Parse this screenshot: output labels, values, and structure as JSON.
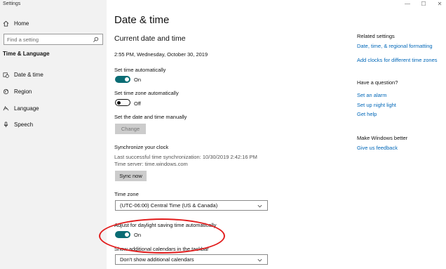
{
  "window": {
    "title": "Settings"
  },
  "sidebar": {
    "home_label": "Home",
    "search_placeholder": "Find a setting",
    "section_label": "Time & Language",
    "items": [
      {
        "label": "Date & time",
        "icon": "calendar-clock-icon"
      },
      {
        "label": "Region",
        "icon": "globe-icon"
      },
      {
        "label": "Language",
        "icon": "language-icon"
      },
      {
        "label": "Speech",
        "icon": "microphone-icon"
      }
    ]
  },
  "main": {
    "page_title": "Date & time",
    "section_title": "Current date and time",
    "current_datetime": "2:55 PM, Wednesday, October 30, 2019",
    "set_time_auto": {
      "label": "Set time automatically",
      "state": "On"
    },
    "set_timezone_auto": {
      "label": "Set time zone automatically",
      "state": "Off"
    },
    "set_manual": {
      "label": "Set the date and time manually",
      "button": "Change"
    },
    "sync": {
      "title": "Synchronize your clock",
      "last_sync": "Last successful time synchronization: 10/30/2019 2:42:16 PM",
      "server": "Time server: time.windows.com",
      "button": "Sync now"
    },
    "timezone": {
      "label": "Time zone",
      "value": "(UTC-06:00) Central Time (US & Canada)"
    },
    "dst": {
      "label": "Adjust for daylight saving time automatically",
      "state": "On"
    },
    "calendars": {
      "label": "Show additional calendars in the taskbar",
      "value": "Don't show additional calendars"
    }
  },
  "right": {
    "related_heading": "Related settings",
    "related_links": [
      "Date, time, & regional formatting",
      "Add clocks for different time zones"
    ],
    "question_heading": "Have a question?",
    "question_links": [
      "Set an alarm",
      "Set up night light",
      "Get help"
    ],
    "better_heading": "Make Windows better",
    "better_link": "Give us feedback"
  },
  "colors": {
    "accent": "#0a6c74",
    "link": "#0067b8",
    "highlight": "#e21b1b"
  }
}
